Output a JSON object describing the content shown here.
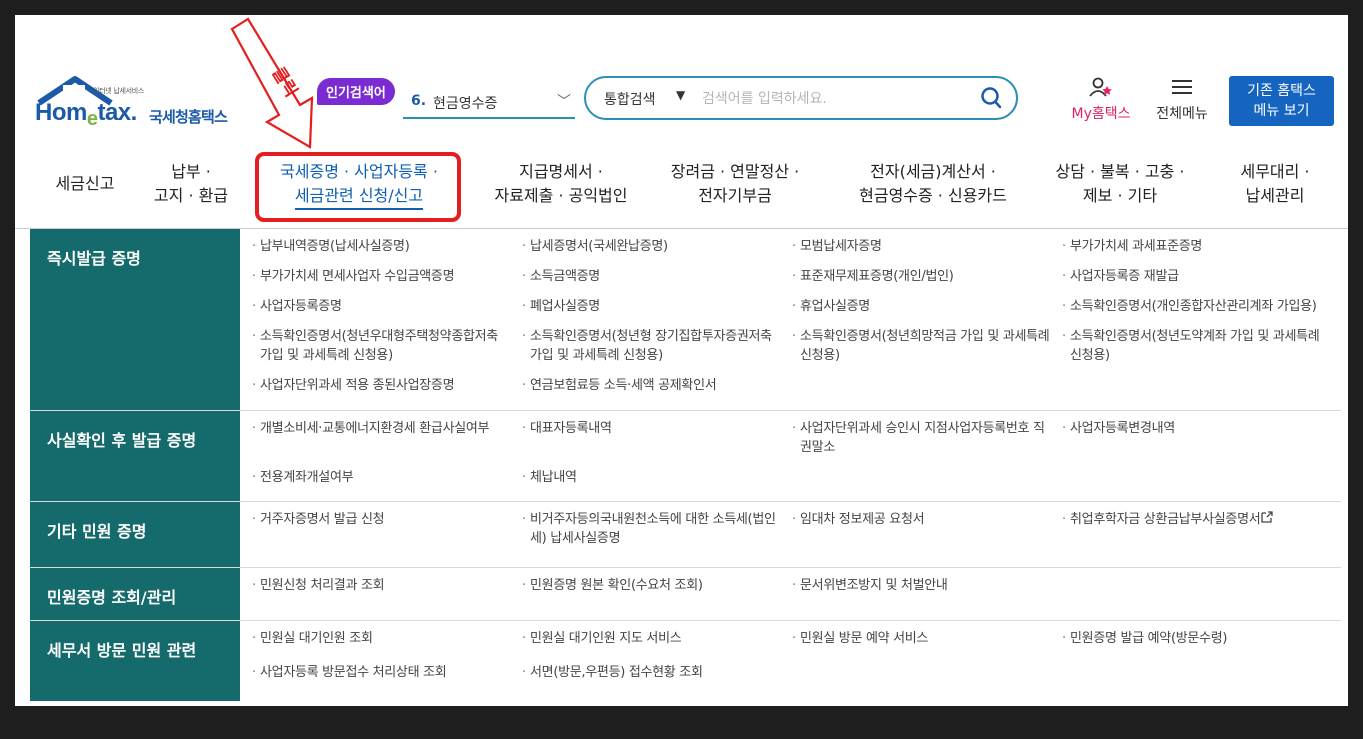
{
  "header": {
    "logo_small": "인터넷 납세서비스",
    "logo_brand_1": "Hom",
    "logo_brand_e": "e",
    "logo_brand_2": "tax.",
    "logo_name": "국세청홈택스",
    "popular_badge": "인기검색어",
    "popular_rank": "6.",
    "popular_term": "현금영수증",
    "search_scope": "통합검색",
    "search_placeholder": "검색어를 입력하세요.",
    "my_home": "My홈택스",
    "all_menu": "전체메뉴",
    "old_menu_1": "기존 홈택스",
    "old_menu_2": "메뉴 보기"
  },
  "annotation": {
    "text": "클릭"
  },
  "gnb": {
    "items": [
      {
        "l1": "세금신고",
        "l2": ""
      },
      {
        "l1": "납부 ·",
        "l2": "고지 · 환급"
      },
      {
        "l1": "국세증명 · 사업자등록 ·",
        "l2": "세금관련 신청/신고"
      },
      {
        "l1": "지급명세서 ·",
        "l2": "자료제출 · 공익법인"
      },
      {
        "l1": "장려금 · 연말정산 ·",
        "l2": "전자기부금"
      },
      {
        "l1": "전자(세금)계산서 ·",
        "l2": "현금영수증 · 신용카드"
      },
      {
        "l1": "상담 · 불복 · 고충 ·",
        "l2": "제보 · 기타"
      },
      {
        "l1": "세무대리 ·",
        "l2": "납세관리"
      }
    ]
  },
  "menu": {
    "sections": [
      {
        "title": "즉시발급 증명",
        "links": [
          "납부내역증명(납세사실증명)",
          "납세증명서(국세완납증명)",
          "모범납세자증명",
          "부가가치세 과세표준증명",
          "부가가치세 면세사업자 수입금액증명",
          "소득금액증명",
          "표준재무제표증명(개인/법인)",
          "사업자등록증 재발급",
          "사업자등록증명",
          "폐업사실증명",
          "휴업사실증명",
          "소득확인증명서(개인종합자산관리계좌 가입용)",
          "소득확인증명서(청년우대형주택청약종합저축 가입 및 과세특례 신청용)",
          "소득확인증명서(청년형 장기집합투자증권저축 가입 및 과세특례 신청용)",
          "소득확인증명서(청년희망적금 가입 및 과세특례 신청용)",
          "소득확인증명서(청년도약계좌 가입 및 과세특례 신청용)",
          "사업자단위과세 적용 종된사업장증명",
          "연금보험료등 소득·세액 공제확인서"
        ]
      },
      {
        "title": "사실확인 후 발급 증명",
        "links": [
          "개별소비세·교통에너지환경세 환급사실여부",
          "대표자등록내역",
          "사업자단위과세 승인시 지점사업자등록번호 직권말소",
          "사업자등록변경내역",
          "전용계좌개설여부",
          "체납내역"
        ]
      },
      {
        "title": "기타 민원 증명",
        "links": [
          "거주자증명서 발급 신청",
          "비거주자등의국내원천소득에 대한 소득세(법인세) 납세사실증명",
          "임대차 정보제공 요청서",
          "취업후학자금 상환금납부사실증명서"
        ]
      },
      {
        "title": "민원증명 조회/관리",
        "links": [
          "민원신청 처리결과 조회",
          "민원증명 원본 확인(수요처 조회)",
          "문서위변조방지 및 처벌안내"
        ]
      },
      {
        "title": "세무서 방문 민원 관련",
        "links": [
          "민원실 대기인원 조회",
          "민원실 대기인원 지도 서비스",
          "민원실 방문 예약 서비스",
          "민원증명 발급 예약(방문수령)",
          "사업자등록 방문접수 처리상태 조회",
          "서면(방문,우편등) 접수현황 조회"
        ]
      }
    ]
  },
  "colors": {
    "accent": "#156a6b",
    "brand": "#1b5aa8",
    "highlight": "#e41e1e",
    "badge": "#7a2bd1"
  }
}
